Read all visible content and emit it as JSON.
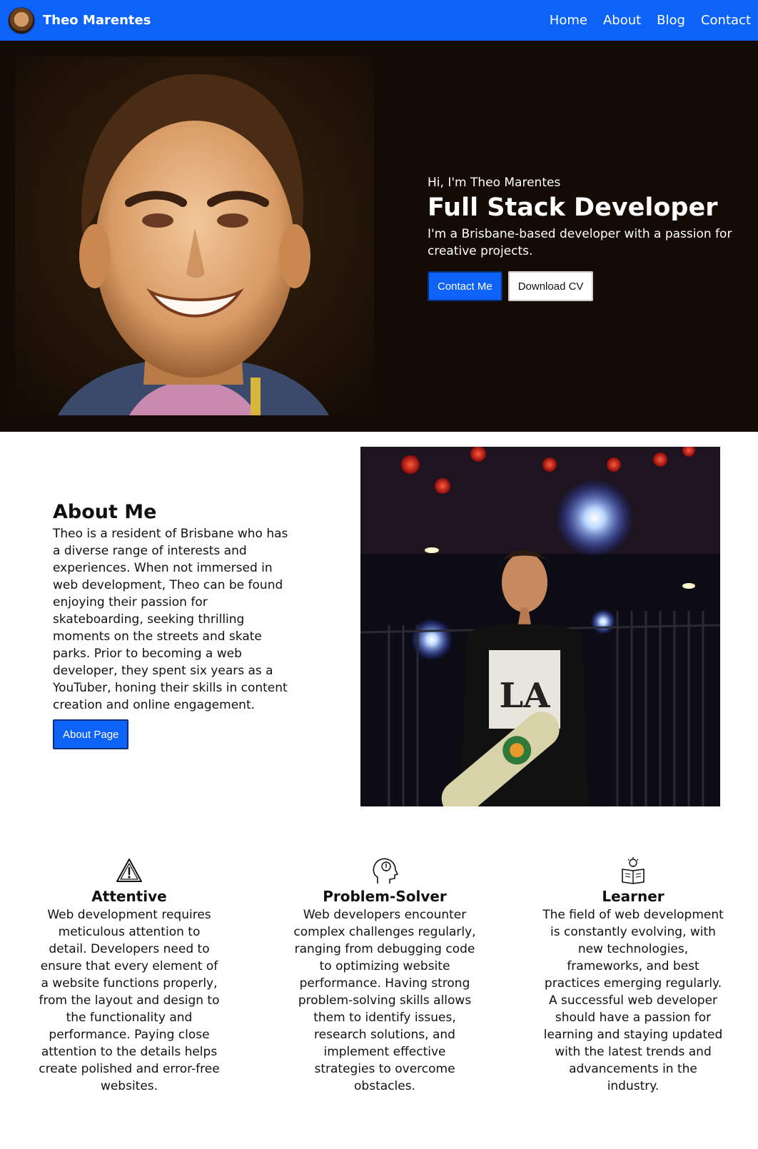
{
  "navbar": {
    "brand_name": "Theo Marentes",
    "links": [
      "Home",
      "About",
      "Blog",
      "Contact"
    ]
  },
  "hero": {
    "greeting": "Hi, I'm Theo Marentes",
    "title": "Full Stack Developer",
    "subtitle": "I'm a Brisbane-based developer with a passion for creative projects.",
    "primary_button": "Contact Me",
    "secondary_button": "Download CV"
  },
  "about": {
    "title": "About Me",
    "body": "Theo is a resident of Brisbane who has a diverse range of interests and experiences. When not immersed in web development, Theo can be found enjoying their passion for skateboarding, seeking thrilling moments on the streets and skate parks. Prior to becoming a web developer, they spent six years as a YouTuber, honing their skills in content creation and online engagement.",
    "button": "About Page"
  },
  "features": [
    {
      "icon": "warning-icon",
      "title": "Attentive",
      "body": "Web development requires meticulous attention to detail. Developers need to ensure that every element of a website functions properly, from the layout and design to the functionality and performance. Paying close attention to the details helps create polished and error-free websites."
    },
    {
      "icon": "head-idea-icon",
      "title": "Problem-Solver",
      "body": "Web developers encounter complex challenges regularly, ranging from debugging code to optimizing website performance. Having strong problem-solving skills allows them to identify issues, research solutions, and implement effective strategies to overcome obstacles."
    },
    {
      "icon": "book-lightbulb-icon",
      "title": "Learner",
      "body": "The field of web development is constantly evolving, with new technologies, frameworks, and best practices emerging regularly. A successful web developer should have a passion for learning and staying updated with the latest trends and advancements in the industry."
    }
  ],
  "colors": {
    "accent": "#0d63f8",
    "hero_background": "#140c04"
  }
}
